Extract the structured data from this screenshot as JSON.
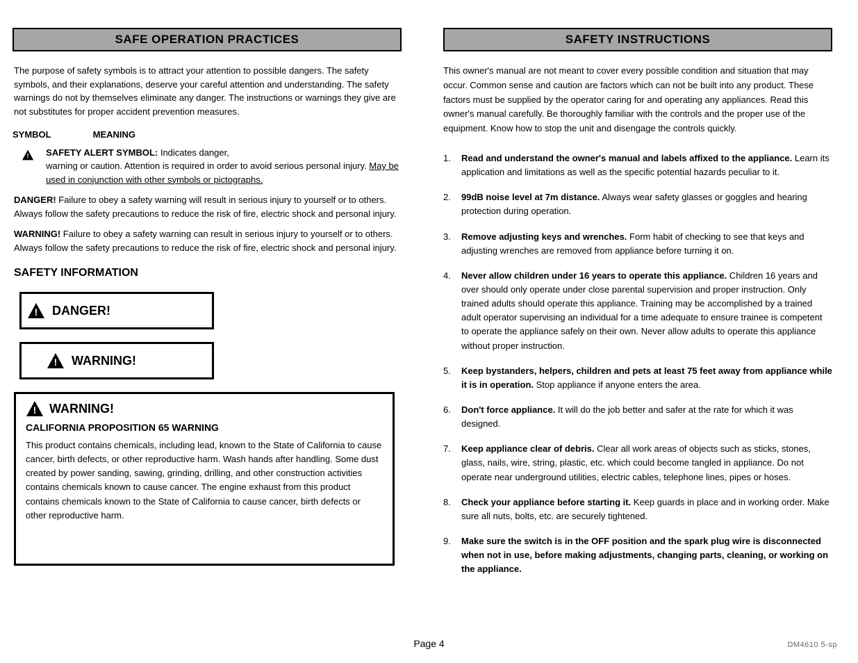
{
  "left": {
    "header": "SAFE OPERATION PRACTICES",
    "p1": "The purpose of safety symbols is to attract your attention to possible dangers. The safety symbols, and their explanations, deserve your careful attention and understanding. The safety warnings do not by themselves eliminate any danger. The instructions or warnings they give are not substitutes for proper accident prevention measures.",
    "symbol_label": "SYMBOL",
    "meaning_label": "MEANING",
    "alert_title": "SAFETY ALERT SYMBOL:",
    "alert_body_1": " Indicates danger,",
    "alert_body_2": "warning or caution. Attention is required in order to avoid serious personal injury. ",
    "alert_body_3": "May be used in conjunction with other symbols or pictographs.",
    "danger_label": "DANGER!",
    "danger_body": "Failure to obey a safety warning will result in serious injury to yourself or to others. Always follow the safety precautions to reduce the risk of fire, electric shock and personal injury.",
    "warning_box_label": "WARNING!",
    "warning_box_body": "Failure to obey a safety warning can result in serious injury to yourself or to others. Always follow the safety precautions to reduce the risk of fire, electric shock and personal injury.",
    "safety_hdr": "SAFETY INFORMATION",
    "narrow1": "DANGER!",
    "narrow2": "WARNING!",
    "wide_header": "WARNING!",
    "wide_sub": "CALIFORNIA PROPOSITION 65 WARNING",
    "wide_body": "This product contains chemicals, including lead, known to the State of California to cause cancer, birth defects, or other reproductive harm. Wash hands after handling. Some dust created by power sanding, sawing, grinding, drilling, and other construction activities contains chemicals known to cause cancer. The engine exhaust from this product contains chemicals known to the State of California to cause cancer, birth defects or other reproductive harm."
  },
  "right": {
    "header": "SAFETY INSTRUCTIONS",
    "intro": "This owner's manual are not meant to cover every possible condition and situation that may occur. Common sense and caution are factors which can not be built into any product. These factors must be supplied by the operator caring for and operating any appliances. Read this owner's manual carefully. Be thoroughly familiar with the controls and the proper use of the equipment. Know how to stop the unit and disengage the controls quickly.",
    "rules": [
      {
        "n": "1.",
        "b": "Read and understand the owner's manual and labels affixed to the appliance.",
        "t": " Learn its application and limitations as well as the specific potential hazards peculiar to it."
      },
      {
        "n": "2.",
        "b": "99dB noise level at 7m distance.",
        "t": " Always wear safety glasses or goggles and hearing protection during operation."
      },
      {
        "n": "3.",
        "b": "Remove adjusting keys and wrenches.",
        "t": " Form habit of checking to see that keys and adjusting wrenches are removed from appliance before turning it on."
      },
      {
        "n": "4.",
        "b": "Never allow children under 16 years to operate this appliance.",
        "t": " Children 16 years and over should only operate under close parental supervision and proper instruction. Only trained adults should operate this appliance. Training may be accomplished by a trained adult operator supervising an individual for a time adequate to ensure trainee is competent to operate the appliance safely on their own. Never allow adults to operate this appliance without proper instruction."
      },
      {
        "n": "5.",
        "b": "Keep bystanders, helpers, children and pets at least 75 feet away from appliance while it is in operation.",
        "t": " Stop appliance if anyone enters the area."
      },
      {
        "n": "6.",
        "b": "Don't force appliance.",
        "t": " It will do the job better and safer at the rate for which it was designed."
      },
      {
        "n": "7.",
        "b": "Keep appliance clear of debris.",
        "t": " Clear all work areas of objects such as sticks, stones, glass, nails, wire, string, plastic, etc. which could become tangled in appliance. Do not operate near underground utilities, electric cables, telephone lines, pipes or hoses."
      },
      {
        "n": "8.",
        "b": "Check your appliance before starting it.",
        "t": " Keep guards in place and in working order. Make sure all nuts, bolts, etc. are securely tightened."
      },
      {
        "n": "9.",
        "b": "Make sure the switch is in the OFF position and the spark plug wire is disconnected when not in use, before making adjustments, changing parts, cleaning, or working on the appliance.",
        "t": ""
      }
    ]
  },
  "footer": {
    "page": "Page 4",
    "code": "DM4610 5-sp"
  }
}
